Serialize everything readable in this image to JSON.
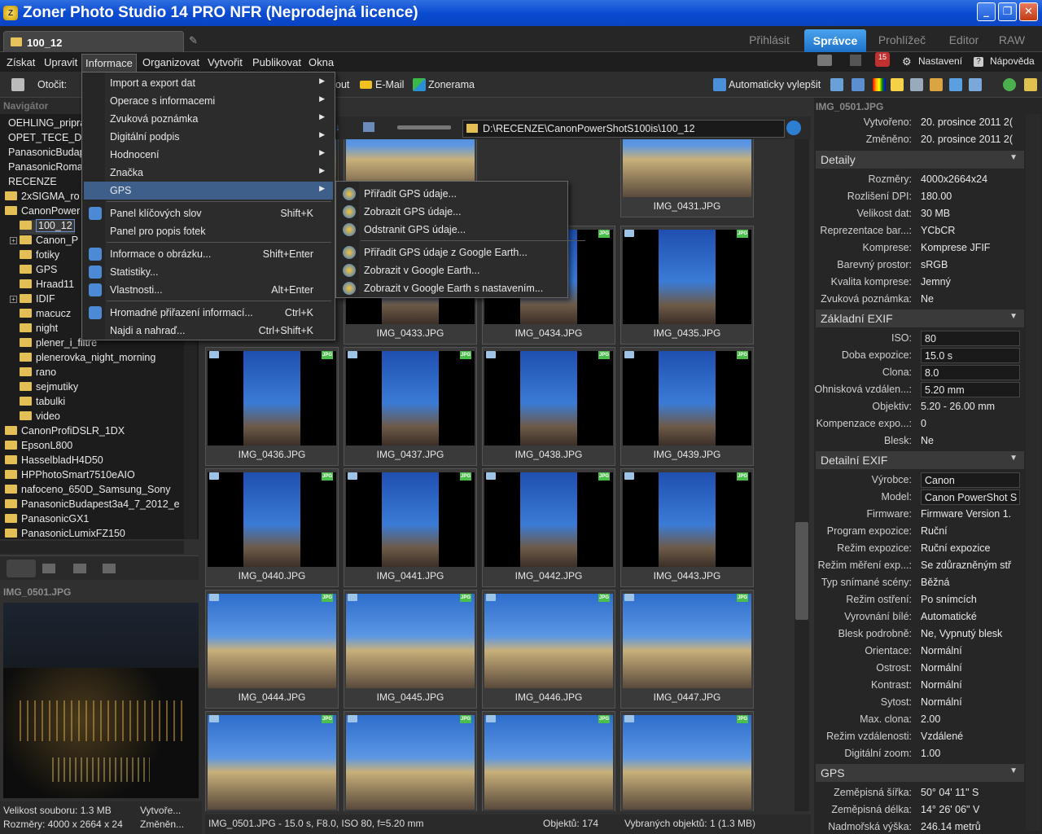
{
  "window": {
    "title": "Zoner Photo Studio 14 PRO NFR (Neprodejná licence)",
    "minimize": "_",
    "maximize": "❐",
    "close": "✕"
  },
  "tab": {
    "doc_title": "100_12"
  },
  "modes": [
    {
      "label": "Přihlásit"
    },
    {
      "label": "Správce"
    },
    {
      "label": "Prohlížeč"
    },
    {
      "label": "Editor"
    },
    {
      "label": "RAW"
    }
  ],
  "menu": {
    "items": [
      "Získat",
      "Upravit",
      "Informace",
      "Organizovat",
      "Vytvořit",
      "Publikovat",
      "Okna"
    ],
    "badge": "15",
    "settings": "Nastavení",
    "help": "Nápověda"
  },
  "toolbar": {
    "rotate": "Otočit:",
    "layout": "out",
    "email": "E-Mail",
    "zonerama": "Zonerama",
    "autofix": "Automaticky vylepšit"
  },
  "navigator": {
    "title": "Navigátor",
    "items": [
      "OEHLING_pripra",
      "OPET_TECE_DO",
      "PanasonicBudap",
      "PanasonicRoma",
      "RECENZE",
      "2xSIGMA_ro",
      "CanonPower",
      "100_12",
      "Canon_P",
      "fotiky",
      "GPS",
      "Hraad11",
      "IDIF",
      "macucz",
      "night",
      "plener_i_filtre",
      "plenerovka_night_morning",
      "rano",
      "sejmutiky",
      "tabulki",
      "video",
      "CanonProfiDSLR_1DX",
      "EpsonL800",
      "HasselbladH4D50",
      "HPPhotoSmart7510eAIO",
      "nafoceno_650D_Samsung_Sony",
      "PanasonicBudapest3a4_7_2012_e",
      "PanasonicGX1",
      "PanasonicLumixFZ150"
    ]
  },
  "preview": {
    "title": "IMG_0501.JPG"
  },
  "status_left": {
    "size": "Velikost souboru: 1.3 MB",
    "created": "Vytvoře...",
    "dims": "Rozměry: 4000 x 2664 x 24",
    "changed": "Změněn..."
  },
  "path": "D:\\RECENZE\\CanonPowerShotS100is\\100_12",
  "thumbs": [
    {
      "name": "",
      "kind": "land"
    },
    {
      "name": "",
      "kind": "land"
    },
    {
      "name": "IMG_0431.JPG",
      "kind": "land"
    },
    {
      "name": "IMG_0433.JPG",
      "kind": "port"
    },
    {
      "name": "IMG_0434.JPG",
      "kind": "port"
    },
    {
      "name": "IMG_0435.JPG",
      "kind": "port"
    },
    {
      "name": "IMG_0436.JPG",
      "kind": "port"
    },
    {
      "name": "IMG_0437.JPG",
      "kind": "port"
    },
    {
      "name": "IMG_0438.JPG",
      "kind": "port"
    },
    {
      "name": "IMG_0439.JPG",
      "kind": "port"
    },
    {
      "name": "IMG_0440.JPG",
      "kind": "port"
    },
    {
      "name": "IMG_0441.JPG",
      "kind": "port"
    },
    {
      "name": "IMG_0442.JPG",
      "kind": "port"
    },
    {
      "name": "IMG_0443.JPG",
      "kind": "port"
    },
    {
      "name": "IMG_0444.JPG",
      "kind": "land"
    },
    {
      "name": "IMG_0445.JPG",
      "kind": "land"
    },
    {
      "name": "IMG_0446.JPG",
      "kind": "land"
    },
    {
      "name": "IMG_0447.JPG",
      "kind": "land"
    },
    {
      "name": "",
      "kind": "land"
    },
    {
      "name": "",
      "kind": "land"
    },
    {
      "name": "",
      "kind": "land"
    },
    {
      "name": "",
      "kind": "land"
    }
  ],
  "status_center": {
    "info": "IMG_0501.JPG - 15.0 s, F8.0, ISO 80, f=5.20 mm",
    "objects": "Objektů: 174",
    "selected": "Vybraných objektů: 1 (1.3 MB)"
  },
  "right": {
    "title": "IMG_0501.JPG",
    "top_props": [
      {
        "k": "Vytvořeno:",
        "v": "20. prosince 2011 2("
      },
      {
        "k": "Změněno:",
        "v": "20. prosince 2011 2("
      }
    ],
    "sections": [
      {
        "title": "Detaily",
        "props": [
          {
            "k": "Rozměry:",
            "v": "4000x2664x24"
          },
          {
            "k": "Rozlišení DPI:",
            "v": "180.00"
          },
          {
            "k": "Velikost dat:",
            "v": "30 MB"
          },
          {
            "k": "Reprezentace bar...:",
            "v": "YCbCR"
          },
          {
            "k": "Komprese:",
            "v": "Komprese JFIF"
          },
          {
            "k": "Barevný prostor:",
            "v": "sRGB"
          },
          {
            "k": "Kvalita komprese:",
            "v": "Jemný"
          },
          {
            "k": "Zvuková poznámka:",
            "v": "Ne"
          }
        ]
      },
      {
        "title": "Základní EXIF",
        "props": [
          {
            "k": "ISO:",
            "v": "80",
            "box": true
          },
          {
            "k": "Doba expozice:",
            "v": "15.0 s",
            "box": true
          },
          {
            "k": "Clona:",
            "v": "8.0",
            "box": true
          },
          {
            "k": "Ohnisková vzdálen...:",
            "v": "5.20 mm",
            "box": true
          },
          {
            "k": "Objektiv:",
            "v": "5.20 - 26.00 mm"
          },
          {
            "k": "Kompenzace expo...:",
            "v": "0"
          },
          {
            "k": "Blesk:",
            "v": "Ne"
          }
        ]
      },
      {
        "title": "Detailní EXIF",
        "props": [
          {
            "k": "Výrobce:",
            "v": "Canon",
            "box": true
          },
          {
            "k": "Model:",
            "v": "Canon PowerShot S",
            "box": true
          },
          {
            "k": "Firmware:",
            "v": "Firmware Version 1."
          },
          {
            "k": "Program expozice:",
            "v": "Ruční"
          },
          {
            "k": "Režim expozice:",
            "v": "Ruční expozice"
          },
          {
            "k": "Režim měření exp...:",
            "v": "Se zdůrazněným stř"
          },
          {
            "k": "Typ snímané scény:",
            "v": "Běžná"
          },
          {
            "k": "Režim ostření:",
            "v": "Po snímcích"
          },
          {
            "k": "Vyrovnání bílé:",
            "v": "Automatické"
          },
          {
            "k": "Blesk podrobně:",
            "v": "Ne, Vypnutý blesk"
          },
          {
            "k": "Orientace:",
            "v": "Normální"
          },
          {
            "k": "Ostrost:",
            "v": "Normální"
          },
          {
            "k": "Kontrast:",
            "v": "Normální"
          },
          {
            "k": "Sytost:",
            "v": "Normální"
          },
          {
            "k": "Max. clona:",
            "v": "2.00"
          },
          {
            "k": "Režim vzdálenosti:",
            "v": "Vzdálené"
          },
          {
            "k": "Digitální zoom:",
            "v": "1.00"
          }
        ]
      },
      {
        "title": "GPS",
        "props": [
          {
            "k": "Zeměpisná šířka:",
            "v": "50° 04' 11\" S"
          },
          {
            "k": "Zeměpisná délka:",
            "v": "14° 26' 06\" V"
          },
          {
            "k": "Nadmořská výška:",
            "v": "246.14 metrů"
          }
        ]
      }
    ]
  },
  "dropdown": [
    {
      "label": "Import a export dat",
      "arrow": true
    },
    {
      "label": "Operace s informacemi",
      "arrow": true
    },
    {
      "label": "Zvuková poznámka",
      "arrow": true
    },
    {
      "label": "Digitální podpis",
      "arrow": true
    },
    {
      "label": "Hodnocení",
      "arrow": true
    },
    {
      "label": "Značka",
      "arrow": true
    },
    {
      "label": "GPS",
      "arrow": true,
      "hl": true
    },
    {
      "sep": true
    },
    {
      "label": "Panel klíčových slov",
      "shortcut": "Shift+K",
      "icon": "keyword-icon"
    },
    {
      "label": "Panel pro popis fotek",
      "icon": ""
    },
    {
      "sep": true
    },
    {
      "label": "Informace o obrázku...",
      "shortcut": "Shift+Enter",
      "icon": "info-icon"
    },
    {
      "label": "Statistiky...",
      "icon": "stats-icon"
    },
    {
      "label": "Vlastnosti...",
      "shortcut": "Alt+Enter",
      "icon": "properties-icon"
    },
    {
      "sep": true
    },
    {
      "label": "Hromadné přiřazení informací...",
      "shortcut": "Ctrl+K",
      "icon": "batch-icon"
    },
    {
      "label": "Najdi a nahraď...",
      "shortcut": "Ctrl+Shift+K",
      "icon": ""
    }
  ],
  "submenu": [
    {
      "label": "Přiřadit GPS údaje..."
    },
    {
      "label": "Zobrazit GPS údaje..."
    },
    {
      "label": "Odstranit GPS údaje..."
    },
    {
      "sep": true
    },
    {
      "label": "Přiřadit GPS údaje z Google Earth..."
    },
    {
      "label": "Zobrazit v Google Earth..."
    },
    {
      "label": "Zobrazit v Google Earth s nastavením..."
    }
  ],
  "colors": {
    "accent": "#1c72c9",
    "highlight": "#3e5f8a",
    "folder": "#e4bf55"
  }
}
